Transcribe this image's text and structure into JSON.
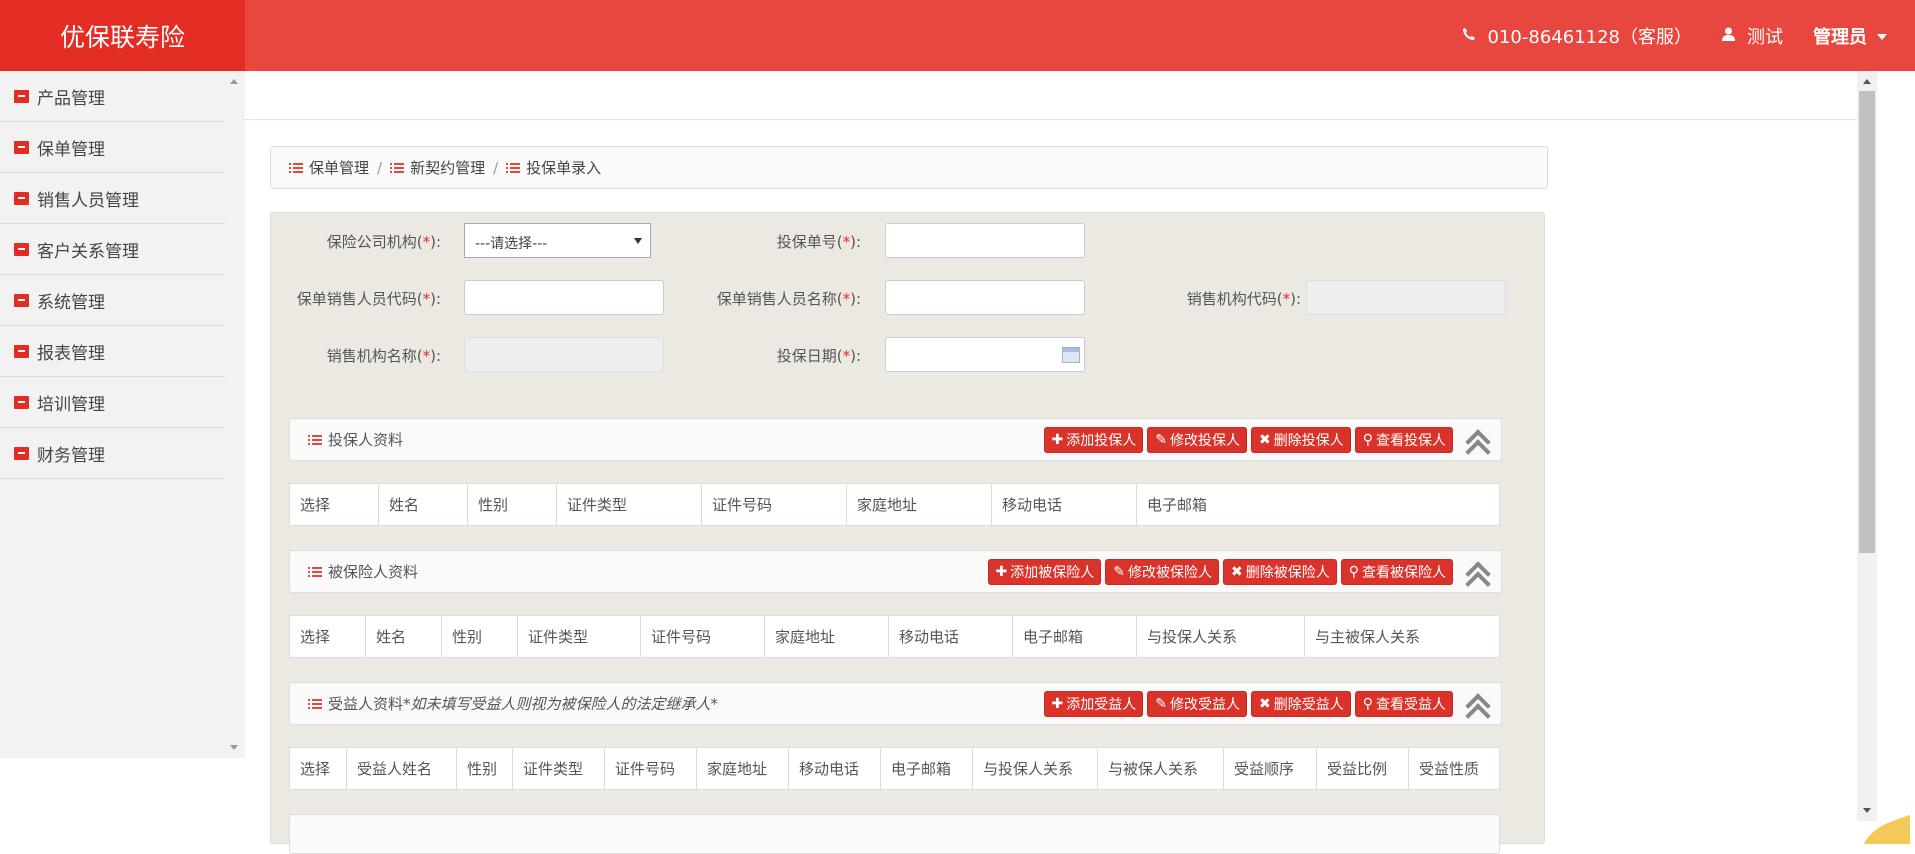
{
  "header": {
    "logo": "优保联寿险",
    "phone": "010-86461128（客服）",
    "user": "测试",
    "role": "管理员"
  },
  "sidebar": {
    "items": [
      {
        "label": "产品管理"
      },
      {
        "label": "保单管理"
      },
      {
        "label": "销售人员管理"
      },
      {
        "label": "客户关系管理"
      },
      {
        "label": "系统管理"
      },
      {
        "label": "报表管理"
      },
      {
        "label": "培训管理"
      },
      {
        "label": "财务管理"
      }
    ]
  },
  "breadcrumb": [
    "保单管理",
    "新契约管理",
    "投保单录入"
  ],
  "form": {
    "company_label": "保险公司机构",
    "company_select": "---请选择---",
    "policy_no_label": "投保单号",
    "sales_code_label": "保单销售人员代码",
    "sales_name_label": "保单销售人员名称",
    "org_code_label": "销售机构代码",
    "org_name_label": "销售机构名称",
    "date_label": "投保日期",
    "star": "*"
  },
  "applicant": {
    "title": "投保人资料",
    "buttons": [
      "添加投保人",
      "修改投保人",
      "删除投保人",
      "查看投保人"
    ],
    "columns": [
      "选择",
      "姓名",
      "性别",
      "证件类型",
      "证件号码",
      "家庭地址",
      "移动电话",
      "电子邮箱"
    ]
  },
  "insured": {
    "title": "被保险人资料",
    "buttons": [
      "添加被保险人",
      "修改被保险人",
      "删除被保险人",
      "查看被保险人"
    ],
    "columns": [
      "选择",
      "姓名",
      "性别",
      "证件类型",
      "证件号码",
      "家庭地址",
      "移动电话",
      "电子邮箱",
      "与投保人关系",
      "与主被保人关系"
    ]
  },
  "beneficiary": {
    "title": "受益人资料",
    "note": "*如未填写受益人则视为被保险人的法定继承人*",
    "buttons": [
      "添加受益人",
      "修改受益人",
      "删除受益人",
      "查看受益人"
    ],
    "columns": [
      "选择",
      "受益人姓名",
      "性别",
      "证件类型",
      "证件号码",
      "家庭地址",
      "移动电话",
      "电子邮箱",
      "与投保人关系",
      "与被保人关系",
      "受益顺序",
      "受益比例",
      "受益性质"
    ]
  },
  "colors": {
    "brand": "#e32d24",
    "header": "#e8473f",
    "button": "#d9332b"
  }
}
